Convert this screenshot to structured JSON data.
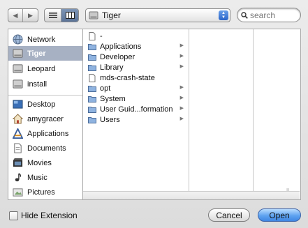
{
  "toolbar": {
    "location_popup": {
      "label": "Tiger",
      "icon": "hard-drive-icon"
    },
    "search": {
      "placeholder": "search"
    }
  },
  "sidebar": {
    "devices": [
      {
        "label": "Network",
        "icon": "network-globe-icon",
        "selected": false
      },
      {
        "label": "Tiger",
        "icon": "hard-drive-icon",
        "selected": true
      },
      {
        "label": "Leopard",
        "icon": "hard-drive-icon",
        "selected": false
      },
      {
        "label": "install",
        "icon": "hard-drive-icon",
        "selected": false
      }
    ],
    "places": [
      {
        "label": "Desktop",
        "icon": "desktop-icon"
      },
      {
        "label": "amygracer",
        "icon": "home-icon"
      },
      {
        "label": "Applications",
        "icon": "applications-icon"
      },
      {
        "label": "Documents",
        "icon": "documents-icon"
      },
      {
        "label": "Movies",
        "icon": "movies-icon"
      },
      {
        "label": "Music",
        "icon": "music-icon"
      },
      {
        "label": "Pictures",
        "icon": "pictures-icon"
      }
    ]
  },
  "browser": {
    "column1": [
      {
        "label": "-",
        "icon": "document-icon",
        "has_children": false
      },
      {
        "label": "Applications",
        "icon": "folder-icon",
        "has_children": true
      },
      {
        "label": "Developer",
        "icon": "folder-icon",
        "has_children": true
      },
      {
        "label": "Library",
        "icon": "folder-icon",
        "has_children": true
      },
      {
        "label": "mds-crash-state",
        "icon": "document-icon",
        "has_children": false
      },
      {
        "label": "opt",
        "icon": "folder-icon",
        "has_children": true
      },
      {
        "label": "System",
        "icon": "folder-icon",
        "has_children": true
      },
      {
        "label": "User Guid...formation",
        "icon": "folder-icon",
        "has_children": true
      },
      {
        "label": "Users",
        "icon": "folder-icon",
        "has_children": true
      }
    ]
  },
  "footer": {
    "hide_extension_label": "Hide Extension",
    "hide_extension_checked": false,
    "cancel_label": "Cancel",
    "open_label": "Open"
  },
  "colors": {
    "selection": "#a7b1c3",
    "default_button": "#5ea3f0",
    "window_background": "#e2e2e2"
  }
}
